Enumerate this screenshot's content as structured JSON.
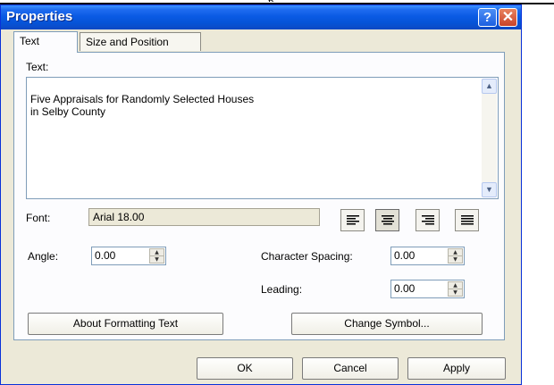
{
  "page_fragment": "p",
  "window": {
    "title": "Properties",
    "help_glyph": "?",
    "close_glyph": "✕"
  },
  "tabs": [
    {
      "label": "Text",
      "active": true
    },
    {
      "label": "Size and Position",
      "active": false
    }
  ],
  "text_section": {
    "label": "Text:",
    "value": "Five Appraisals for Randomly Selected Houses\nin Selby County"
  },
  "font": {
    "label": "Font:",
    "value": "Arial 18.00"
  },
  "alignment": {
    "options": [
      "align-left-icon",
      "align-center-icon",
      "align-right-icon",
      "align-justify-icon"
    ],
    "selected": "align-center-icon"
  },
  "angle": {
    "label": "Angle:",
    "value": "0.00"
  },
  "character_spacing": {
    "label": "Character Spacing:",
    "value": "0.00"
  },
  "leading": {
    "label": "Leading:",
    "value": "0.00"
  },
  "buttons": {
    "about": "About Formatting Text",
    "change_symbol": "Change Symbol...",
    "ok": "OK",
    "cancel": "Cancel",
    "apply": "Apply"
  },
  "colors": {
    "titlebar": "#0a5ae4",
    "dialog_bg": "#ece9d8",
    "panel_bg": "#fcfcfe",
    "close_button": "#c8432a"
  }
}
